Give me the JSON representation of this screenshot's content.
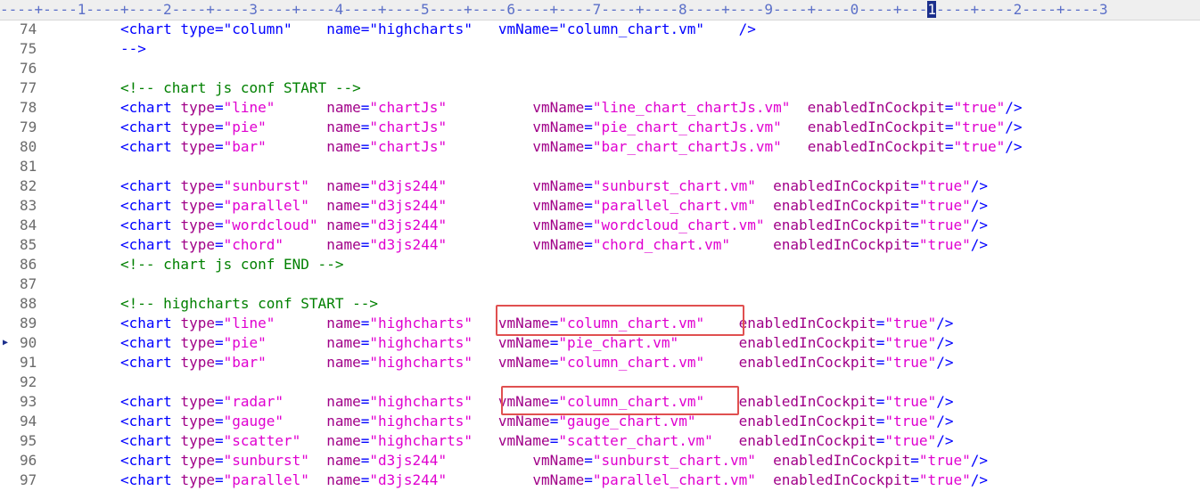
{
  "ruler": {
    "before": "----+----1----+----2----+----3----+----4----+----5----+----6----+----7----+----8----+----9----+----0----+---",
    "cursor_char": "1",
    "after": "----+----2----+----3"
  },
  "lines": [
    {
      "num": "74",
      "segments": [
        [
          "t",
          "<chart type=\"column\"    name=\"highcharts\"   vmName=\"column_chart.vm\"    />"
        ]
      ]
    },
    {
      "num": "75",
      "segments": [
        [
          "t",
          "-->"
        ]
      ]
    },
    {
      "num": "76",
      "segments": []
    },
    {
      "num": "77",
      "segments": [
        [
          "c",
          "<!-- chart js conf START -->"
        ]
      ]
    },
    {
      "num": "78",
      "segments": [
        [
          "t",
          "<chart "
        ],
        [
          "a",
          "type"
        ],
        [
          "t",
          "="
        ],
        [
          "v",
          "\"line\""
        ],
        [
          "t",
          "      "
        ],
        [
          "a",
          "name"
        ],
        [
          "t",
          "="
        ],
        [
          "v",
          "\"chartJs\""
        ],
        [
          "t",
          "          "
        ],
        [
          "a",
          "vmName"
        ],
        [
          "t",
          "="
        ],
        [
          "v",
          "\"line_chart_chartJs.vm\""
        ],
        [
          "t",
          "  "
        ],
        [
          "a",
          "enabledInCockpit"
        ],
        [
          "t",
          "="
        ],
        [
          "v",
          "\"true\""
        ],
        [
          "t",
          "/>"
        ]
      ]
    },
    {
      "num": "79",
      "segments": [
        [
          "t",
          "<chart "
        ],
        [
          "a",
          "type"
        ],
        [
          "t",
          "="
        ],
        [
          "v",
          "\"pie\""
        ],
        [
          "t",
          "       "
        ],
        [
          "a",
          "name"
        ],
        [
          "t",
          "="
        ],
        [
          "v",
          "\"chartJs\""
        ],
        [
          "t",
          "          "
        ],
        [
          "a",
          "vmName"
        ],
        [
          "t",
          "="
        ],
        [
          "v",
          "\"pie_chart_chartJs.vm\""
        ],
        [
          "t",
          "   "
        ],
        [
          "a",
          "enabledInCockpit"
        ],
        [
          "t",
          "="
        ],
        [
          "v",
          "\"true\""
        ],
        [
          "t",
          "/>"
        ]
      ]
    },
    {
      "num": "80",
      "segments": [
        [
          "t",
          "<chart "
        ],
        [
          "a",
          "type"
        ],
        [
          "t",
          "="
        ],
        [
          "v",
          "\"bar\""
        ],
        [
          "t",
          "       "
        ],
        [
          "a",
          "name"
        ],
        [
          "t",
          "="
        ],
        [
          "v",
          "\"chartJs\""
        ],
        [
          "t",
          "          "
        ],
        [
          "a",
          "vmName"
        ],
        [
          "t",
          "="
        ],
        [
          "v",
          "\"bar_chart_chartJs.vm\""
        ],
        [
          "t",
          "   "
        ],
        [
          "a",
          "enabledInCockpit"
        ],
        [
          "t",
          "="
        ],
        [
          "v",
          "\"true\""
        ],
        [
          "t",
          "/>"
        ]
      ]
    },
    {
      "num": "81",
      "segments": []
    },
    {
      "num": "82",
      "segments": [
        [
          "t",
          "<chart "
        ],
        [
          "a",
          "type"
        ],
        [
          "t",
          "="
        ],
        [
          "v",
          "\"sunburst\""
        ],
        [
          "t",
          "  "
        ],
        [
          "a",
          "name"
        ],
        [
          "t",
          "="
        ],
        [
          "v",
          "\"d3js244\""
        ],
        [
          "t",
          "          "
        ],
        [
          "a",
          "vmName"
        ],
        [
          "t",
          "="
        ],
        [
          "v",
          "\"sunburst_chart.vm\""
        ],
        [
          "t",
          "  "
        ],
        [
          "a",
          "enabledInCockpit"
        ],
        [
          "t",
          "="
        ],
        [
          "v",
          "\"true\""
        ],
        [
          "t",
          "/>"
        ]
      ]
    },
    {
      "num": "83",
      "segments": [
        [
          "t",
          "<chart "
        ],
        [
          "a",
          "type"
        ],
        [
          "t",
          "="
        ],
        [
          "v",
          "\"parallel\""
        ],
        [
          "t",
          "  "
        ],
        [
          "a",
          "name"
        ],
        [
          "t",
          "="
        ],
        [
          "v",
          "\"d3js244\""
        ],
        [
          "t",
          "          "
        ],
        [
          "a",
          "vmName"
        ],
        [
          "t",
          "="
        ],
        [
          "v",
          "\"parallel_chart.vm\""
        ],
        [
          "t",
          "  "
        ],
        [
          "a",
          "enabledInCockpit"
        ],
        [
          "t",
          "="
        ],
        [
          "v",
          "\"true\""
        ],
        [
          "t",
          "/>"
        ]
      ]
    },
    {
      "num": "84",
      "segments": [
        [
          "t",
          "<chart "
        ],
        [
          "a",
          "type"
        ],
        [
          "t",
          "="
        ],
        [
          "v",
          "\"wordcloud\""
        ],
        [
          "t",
          " "
        ],
        [
          "a",
          "name"
        ],
        [
          "t",
          "="
        ],
        [
          "v",
          "\"d3js244\""
        ],
        [
          "t",
          "          "
        ],
        [
          "a",
          "vmName"
        ],
        [
          "t",
          "="
        ],
        [
          "v",
          "\"wordcloud_chart.vm\""
        ],
        [
          "t",
          " "
        ],
        [
          "a",
          "enabledInCockpit"
        ],
        [
          "t",
          "="
        ],
        [
          "v",
          "\"true\""
        ],
        [
          "t",
          "/>"
        ]
      ]
    },
    {
      "num": "85",
      "segments": [
        [
          "t",
          "<chart "
        ],
        [
          "a",
          "type"
        ],
        [
          "t",
          "="
        ],
        [
          "v",
          "\"chord\""
        ],
        [
          "t",
          "     "
        ],
        [
          "a",
          "name"
        ],
        [
          "t",
          "="
        ],
        [
          "v",
          "\"d3js244\""
        ],
        [
          "t",
          "          "
        ],
        [
          "a",
          "vmName"
        ],
        [
          "t",
          "="
        ],
        [
          "v",
          "\"chord_chart.vm\""
        ],
        [
          "t",
          "     "
        ],
        [
          "a",
          "enabledInCockpit"
        ],
        [
          "t",
          "="
        ],
        [
          "v",
          "\"true\""
        ],
        [
          "t",
          "/>"
        ]
      ]
    },
    {
      "num": "86",
      "segments": [
        [
          "c",
          "<!-- chart js conf END -->"
        ]
      ]
    },
    {
      "num": "87",
      "segments": []
    },
    {
      "num": "88",
      "segments": [
        [
          "c",
          "<!-- highcharts conf START -->"
        ]
      ]
    },
    {
      "num": "89",
      "segments": [
        [
          "t",
          "<chart "
        ],
        [
          "a",
          "type"
        ],
        [
          "t",
          "="
        ],
        [
          "v",
          "\"line\""
        ],
        [
          "t",
          "      "
        ],
        [
          "a",
          "name"
        ],
        [
          "t",
          "="
        ],
        [
          "v",
          "\"highcharts\""
        ],
        [
          "t",
          "   "
        ],
        [
          "a",
          "vmName"
        ],
        [
          "t",
          "="
        ],
        [
          "v",
          "\"column_chart.vm\""
        ],
        [
          "t",
          "    "
        ],
        [
          "a",
          "enabledInCockpit"
        ],
        [
          "t",
          "="
        ],
        [
          "v",
          "\"true\""
        ],
        [
          "t",
          "/>"
        ]
      ]
    },
    {
      "num": "90",
      "bookmark": true,
      "segments": [
        [
          "t",
          "<chart "
        ],
        [
          "a",
          "type"
        ],
        [
          "t",
          "="
        ],
        [
          "v",
          "\"pie\""
        ],
        [
          "t",
          "       "
        ],
        [
          "a",
          "name"
        ],
        [
          "t",
          "="
        ],
        [
          "v",
          "\"highcharts\""
        ],
        [
          "t",
          "   "
        ],
        [
          "a",
          "vmName"
        ],
        [
          "t",
          "="
        ],
        [
          "v",
          "\"pie_chart.vm\""
        ],
        [
          "t",
          "       "
        ],
        [
          "a",
          "enabledInCockpit"
        ],
        [
          "t",
          "="
        ],
        [
          "v",
          "\"true\""
        ],
        [
          "t",
          "/>"
        ]
      ]
    },
    {
      "num": "91",
      "segments": [
        [
          "t",
          "<chart "
        ],
        [
          "a",
          "type"
        ],
        [
          "t",
          "="
        ],
        [
          "v",
          "\"bar\""
        ],
        [
          "t",
          "       "
        ],
        [
          "a",
          "name"
        ],
        [
          "t",
          "="
        ],
        [
          "v",
          "\"highcharts\""
        ],
        [
          "t",
          "   "
        ],
        [
          "a",
          "vmName"
        ],
        [
          "t",
          "="
        ],
        [
          "v",
          "\"column_chart.vm\""
        ],
        [
          "t",
          "    "
        ],
        [
          "a",
          "enabledInCockpit"
        ],
        [
          "t",
          "="
        ],
        [
          "v",
          "\"true\""
        ],
        [
          "t",
          "/>"
        ]
      ]
    },
    {
      "num": "92",
      "segments": []
    },
    {
      "num": "93",
      "segments": [
        [
          "t",
          "<chart "
        ],
        [
          "a",
          "type"
        ],
        [
          "t",
          "="
        ],
        [
          "v",
          "\"radar\""
        ],
        [
          "t",
          "     "
        ],
        [
          "a",
          "name"
        ],
        [
          "t",
          "="
        ],
        [
          "v",
          "\"highcharts\""
        ],
        [
          "t",
          "   "
        ],
        [
          "a",
          "vmName"
        ],
        [
          "t",
          "="
        ],
        [
          "v",
          "\"column_chart.vm\""
        ],
        [
          "t",
          "    "
        ],
        [
          "a",
          "enabledInCockpit"
        ],
        [
          "t",
          "="
        ],
        [
          "v",
          "\"true\""
        ],
        [
          "t",
          "/>"
        ]
      ]
    },
    {
      "num": "94",
      "segments": [
        [
          "t",
          "<chart "
        ],
        [
          "a",
          "type"
        ],
        [
          "t",
          "="
        ],
        [
          "v",
          "\"gauge\""
        ],
        [
          "t",
          "     "
        ],
        [
          "a",
          "name"
        ],
        [
          "t",
          "="
        ],
        [
          "v",
          "\"highcharts\""
        ],
        [
          "t",
          "   "
        ],
        [
          "a",
          "vmName"
        ],
        [
          "t",
          "="
        ],
        [
          "v",
          "\"gauge_chart.vm\""
        ],
        [
          "t",
          "     "
        ],
        [
          "a",
          "enabledInCockpit"
        ],
        [
          "t",
          "="
        ],
        [
          "v",
          "\"true\""
        ],
        [
          "t",
          "/>"
        ]
      ]
    },
    {
      "num": "95",
      "segments": [
        [
          "t",
          "<chart "
        ],
        [
          "a",
          "type"
        ],
        [
          "t",
          "="
        ],
        [
          "v",
          "\"scatter\""
        ],
        [
          "t",
          "   "
        ],
        [
          "a",
          "name"
        ],
        [
          "t",
          "="
        ],
        [
          "v",
          "\"highcharts\""
        ],
        [
          "t",
          "   "
        ],
        [
          "a",
          "vmName"
        ],
        [
          "t",
          "="
        ],
        [
          "v",
          "\"scatter_chart.vm\""
        ],
        [
          "t",
          "   "
        ],
        [
          "a",
          "enabledInCockpit"
        ],
        [
          "t",
          "="
        ],
        [
          "v",
          "\"true\""
        ],
        [
          "t",
          "/>"
        ]
      ]
    },
    {
      "num": "96",
      "segments": [
        [
          "t",
          "<chart "
        ],
        [
          "a",
          "type"
        ],
        [
          "t",
          "="
        ],
        [
          "v",
          "\"sunburst\""
        ],
        [
          "t",
          "  "
        ],
        [
          "a",
          "name"
        ],
        [
          "t",
          "="
        ],
        [
          "v",
          "\"d3js244\""
        ],
        [
          "t",
          "          "
        ],
        [
          "a",
          "vmName"
        ],
        [
          "t",
          "="
        ],
        [
          "v",
          "\"sunburst_chart.vm\""
        ],
        [
          "t",
          "  "
        ],
        [
          "a",
          "enabledInCockpit"
        ],
        [
          "t",
          "="
        ],
        [
          "v",
          "\"true\""
        ],
        [
          "t",
          "/>"
        ]
      ]
    },
    {
      "num": "97",
      "segments": [
        [
          "t",
          "<chart "
        ],
        [
          "a",
          "type"
        ],
        [
          "t",
          "="
        ],
        [
          "v",
          "\"parallel\""
        ],
        [
          "t",
          "  "
        ],
        [
          "a",
          "name"
        ],
        [
          "t",
          "="
        ],
        [
          "v",
          "\"d3js244\""
        ],
        [
          "t",
          "          "
        ],
        [
          "a",
          "vmName"
        ],
        [
          "t",
          "="
        ],
        [
          "v",
          "\"parallel_chart.vm\""
        ],
        [
          "t",
          "  "
        ],
        [
          "a",
          "enabledInCockpit"
        ],
        [
          "t",
          "="
        ],
        [
          "v",
          "\"true\""
        ],
        [
          "t",
          "/>"
        ]
      ]
    }
  ],
  "highlight_box_color": "#e05050",
  "bookmark_icon": "bookmark-arrow-icon"
}
